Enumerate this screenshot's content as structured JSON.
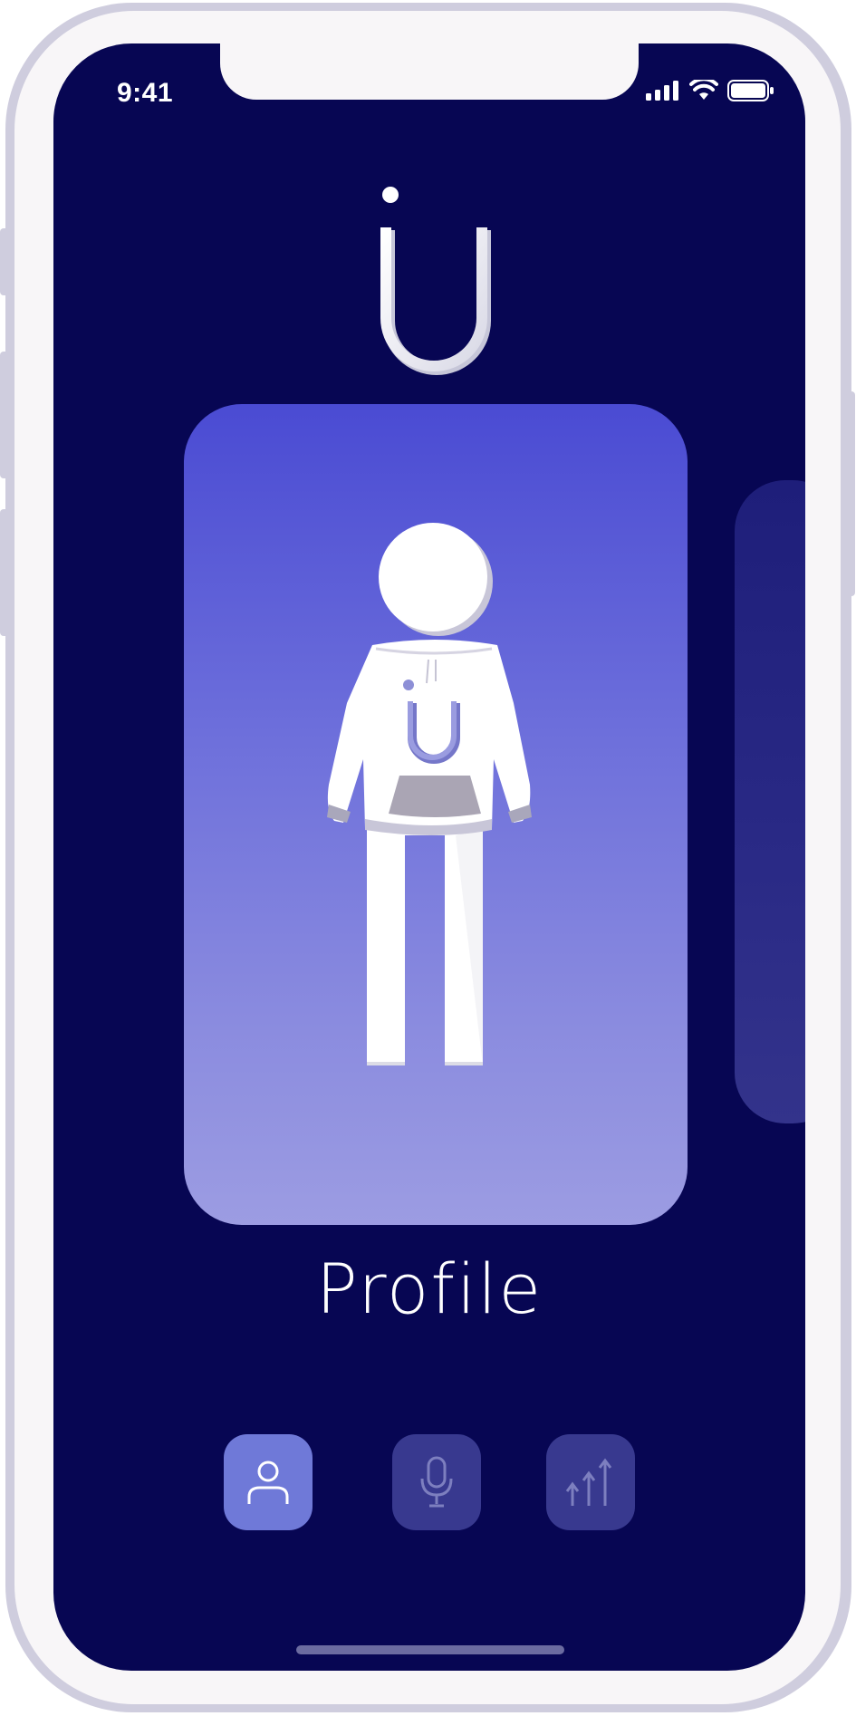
{
  "status_bar": {
    "time": "9:41"
  },
  "app": {
    "logo_name": "u-logo"
  },
  "carousel": {
    "active_card": {
      "label": "Profile",
      "illustration": "person-hoodie-illustration"
    },
    "next_card_peek": true
  },
  "bottom_nav": {
    "items": [
      {
        "icon": "user-icon",
        "active": true
      },
      {
        "icon": "microphone-icon",
        "active": false
      },
      {
        "icon": "rising-arrows-icon",
        "active": false
      }
    ]
  },
  "colors": {
    "screen_bg": "#070653",
    "card_top": "#4a4bd3",
    "card_bottom": "#9c9ce2",
    "nav_active": "#6f79d8",
    "nav_inactive": "#38398f",
    "frame": "#cfcdde",
    "bezel": "#f8f6f8"
  }
}
